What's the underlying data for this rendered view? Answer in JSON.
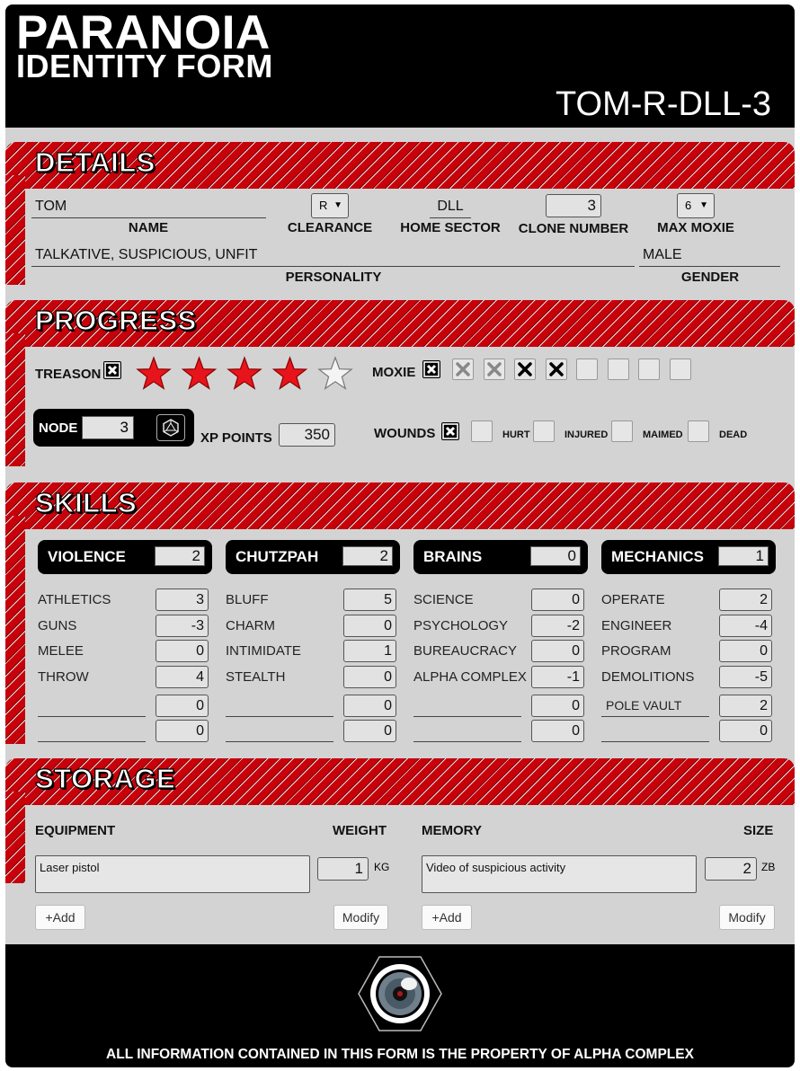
{
  "header": {
    "title": "PARANOIA",
    "subtitle": "IDENTITY FORM",
    "clone_id": "TOM-R-DLL-3"
  },
  "details": {
    "title": "DETAILS",
    "name": {
      "value": "TOM",
      "label": "NAME"
    },
    "clearance": {
      "value": "R",
      "label": "CLEARANCE"
    },
    "home_sector": {
      "value": "DLL",
      "label": "HOME SECTOR"
    },
    "clone_number": {
      "value": "3",
      "label": "CLONE NUMBER"
    },
    "max_moxie": {
      "value": "6",
      "label": "MAX MOXIE"
    },
    "personality": {
      "value": "TALKATIVE, SUSPICIOUS, UNFIT",
      "label": "PERSONALITY"
    },
    "gender": {
      "value": "MALE",
      "label": "GENDER"
    }
  },
  "progress": {
    "title": "PROGRESS",
    "treason_label": "TREASON",
    "treason_stars": {
      "filled": 4,
      "total": 5
    },
    "moxie_label": "MOXIE",
    "moxie_boxes": [
      "grey-x",
      "grey-x",
      "black-x",
      "black-x",
      "empty",
      "empty",
      "empty",
      "empty"
    ],
    "node_label": "NODE",
    "node_value": "3",
    "xp_label": "XP POINTS",
    "xp_value": "350",
    "wounds_label": "WOUNDS",
    "wound_levels": [
      "HURT",
      "INJURED",
      "MAIMED",
      "DEAD"
    ]
  },
  "skills": {
    "title": "SKILLS",
    "groups": [
      {
        "name": "VIOLENCE",
        "value": "2",
        "skills": [
          {
            "name": "ATHLETICS",
            "value": "3"
          },
          {
            "name": "GUNS",
            "value": "-3"
          },
          {
            "name": "MELEE",
            "value": "0"
          },
          {
            "name": "THROW",
            "value": "4"
          },
          {
            "name": "",
            "value": "0"
          },
          {
            "name": "",
            "value": "0"
          }
        ]
      },
      {
        "name": "CHUTZPAH",
        "value": "2",
        "skills": [
          {
            "name": "BLUFF",
            "value": "5"
          },
          {
            "name": "CHARM",
            "value": "0"
          },
          {
            "name": "INTIMIDATE",
            "value": "1"
          },
          {
            "name": "STEALTH",
            "value": "0"
          },
          {
            "name": "",
            "value": "0"
          },
          {
            "name": "",
            "value": "0"
          }
        ]
      },
      {
        "name": "BRAINS",
        "value": "0",
        "skills": [
          {
            "name": "SCIENCE",
            "value": "0"
          },
          {
            "name": "PSYCHOLOGY",
            "value": "-2"
          },
          {
            "name": "BUREAUCRACY",
            "value": "0"
          },
          {
            "name": "ALPHA COMPLEX",
            "value": "-1"
          },
          {
            "name": "",
            "value": "0"
          },
          {
            "name": "",
            "value": "0"
          }
        ]
      },
      {
        "name": "MECHANICS",
        "value": "1",
        "skills": [
          {
            "name": "OPERATE",
            "value": "2"
          },
          {
            "name": "ENGINEER",
            "value": "-4"
          },
          {
            "name": "PROGRAM",
            "value": "0"
          },
          {
            "name": "DEMOLITIONS",
            "value": "-5"
          },
          {
            "name": "POLE VAULT",
            "value": "2"
          },
          {
            "name": "",
            "value": "0"
          }
        ]
      }
    ]
  },
  "storage": {
    "title": "STORAGE",
    "equipment": {
      "header": "EQUIPMENT",
      "weight_header": "WEIGHT",
      "item": "Laser pistol",
      "weight": "1",
      "unit": "KG",
      "add": "+Add",
      "modify": "Modify"
    },
    "memory": {
      "header": "MEMORY",
      "size_header": "SIZE",
      "item": "Video of suspicious activity",
      "size": "2",
      "unit": "ZB",
      "add": "+Add",
      "modify": "Modify"
    }
  },
  "footer": {
    "notice": "ALL INFORMATION CONTAINED IN THIS FORM IS THE PROPERTY OF ALPHA COMPLEX"
  },
  "colors": {
    "accent_red": "#c8000a",
    "panel_grey": "#d3d3d3",
    "black": "#000000"
  }
}
